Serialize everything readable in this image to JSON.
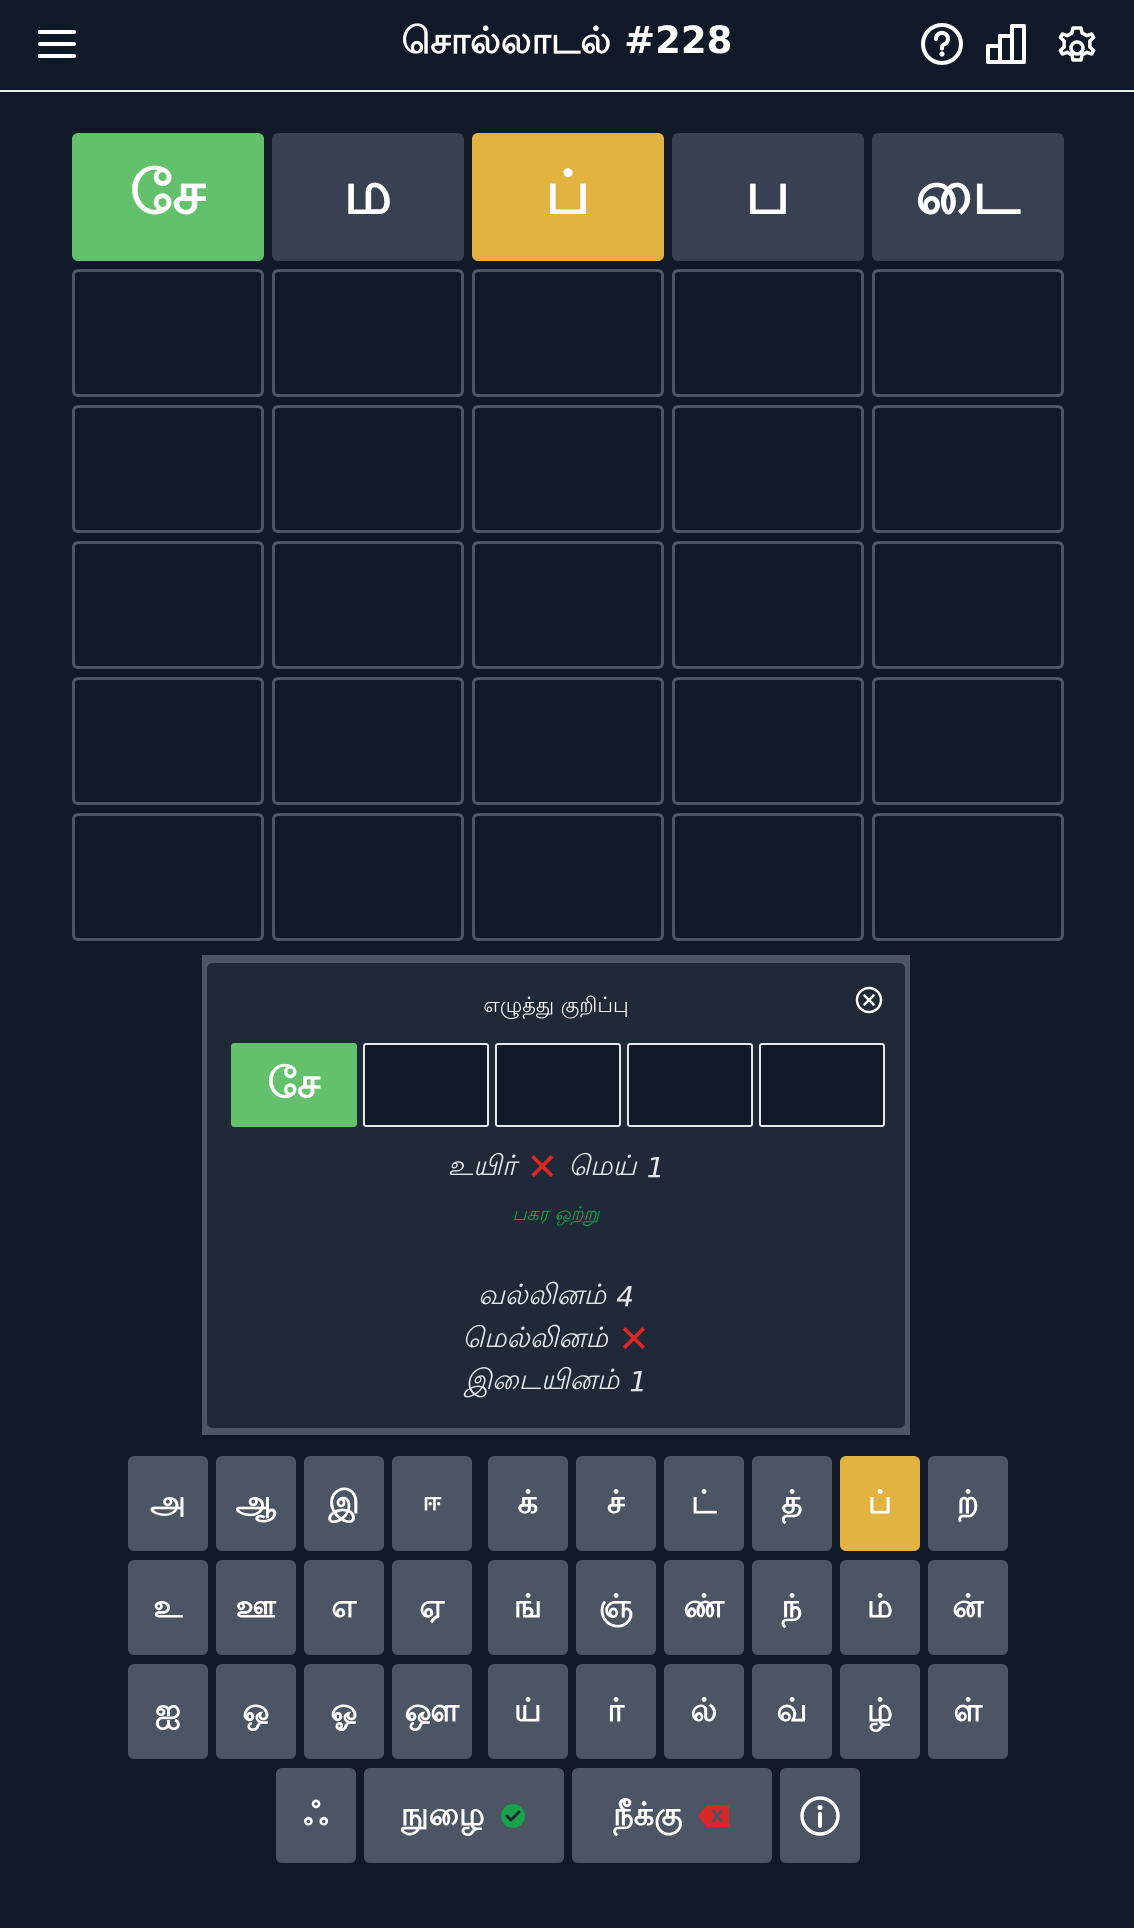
{
  "header": {
    "title": "சொல்லாடல் #228"
  },
  "colors": {
    "green": "#62c16a",
    "yellow": "#e3b341",
    "empty": "#111827",
    "dark": "#374151"
  },
  "board": {
    "rows": [
      [
        {
          "letter": "சே",
          "state": "green"
        },
        {
          "letter": "ம",
          "state": "absent"
        },
        {
          "letter": "ப்",
          "state": "yellow"
        },
        {
          "letter": "ப",
          "state": "absent"
        },
        {
          "letter": "டை",
          "state": "absent"
        }
      ],
      [
        {
          "letter": "",
          "state": "empty"
        },
        {
          "letter": "",
          "state": "empty"
        },
        {
          "letter": "",
          "state": "empty"
        },
        {
          "letter": "",
          "state": "empty"
        },
        {
          "letter": "",
          "state": "empty"
        }
      ],
      [
        {
          "letter": "",
          "state": "empty"
        },
        {
          "letter": "",
          "state": "empty"
        },
        {
          "letter": "",
          "state": "empty"
        },
        {
          "letter": "",
          "state": "empty"
        },
        {
          "letter": "",
          "state": "empty"
        }
      ],
      [
        {
          "letter": "",
          "state": "empty"
        },
        {
          "letter": "",
          "state": "empty"
        },
        {
          "letter": "",
          "state": "empty"
        },
        {
          "letter": "",
          "state": "empty"
        },
        {
          "letter": "",
          "state": "empty"
        }
      ],
      [
        {
          "letter": "",
          "state": "empty"
        },
        {
          "letter": "",
          "state": "empty"
        },
        {
          "letter": "",
          "state": "empty"
        },
        {
          "letter": "",
          "state": "empty"
        },
        {
          "letter": "",
          "state": "empty"
        }
      ],
      [
        {
          "letter": "",
          "state": "empty"
        },
        {
          "letter": "",
          "state": "empty"
        },
        {
          "letter": "",
          "state": "empty"
        },
        {
          "letter": "",
          "state": "empty"
        },
        {
          "letter": "",
          "state": "empty"
        }
      ]
    ]
  },
  "hint": {
    "title": "எழுத்து குறிப்பு",
    "tiles": [
      {
        "letter": "சே",
        "state": "green"
      },
      {
        "letter": "",
        "state": "empty"
      },
      {
        "letter": "",
        "state": "empty"
      },
      {
        "letter": "",
        "state": "empty"
      },
      {
        "letter": "",
        "state": "empty"
      }
    ],
    "uyir_label": "உயிர்",
    "mei_label": "மெய்",
    "mei_count": "1",
    "note": "பகர ஒற்று",
    "vallinam_label": "வல்லினம்",
    "vallinam_count": "4",
    "mellinam_label": "மெல்லினம்",
    "idaiyinam_label": "இடையினம்",
    "idaiyinam_count": "1"
  },
  "keyboard": {
    "rows": [
      [
        {
          "label": "அ",
          "state": "normal"
        },
        {
          "label": "ஆ",
          "state": "normal"
        },
        {
          "label": "இ",
          "state": "normal"
        },
        {
          "label": "ஈ",
          "state": "normal"
        },
        {
          "label": "க்",
          "state": "normal"
        },
        {
          "label": "ச்",
          "state": "normal"
        },
        {
          "label": "ட்",
          "state": "normal"
        },
        {
          "label": "த்",
          "state": "normal"
        },
        {
          "label": "ப்",
          "state": "yellow"
        },
        {
          "label": "ற்",
          "state": "normal"
        }
      ],
      [
        {
          "label": "உ",
          "state": "normal"
        },
        {
          "label": "ஊ",
          "state": "normal"
        },
        {
          "label": "எ",
          "state": "normal"
        },
        {
          "label": "ஏ",
          "state": "normal"
        },
        {
          "label": "ங்",
          "state": "normal"
        },
        {
          "label": "ஞ்",
          "state": "normal"
        },
        {
          "label": "ண்",
          "state": "normal"
        },
        {
          "label": "ந்",
          "state": "normal"
        },
        {
          "label": "ம்",
          "state": "normal"
        },
        {
          "label": "ன்",
          "state": "normal"
        }
      ],
      [
        {
          "label": "ஐ",
          "state": "normal"
        },
        {
          "label": "ஒ",
          "state": "normal"
        },
        {
          "label": "ஓ",
          "state": "normal"
        },
        {
          "label": "ஔ",
          "state": "normal"
        },
        {
          "label": "ய்",
          "state": "normal"
        },
        {
          "label": "ர்",
          "state": "normal"
        },
        {
          "label": "ல்",
          "state": "normal"
        },
        {
          "label": "வ்",
          "state": "normal"
        },
        {
          "label": "ழ்",
          "state": "normal"
        },
        {
          "label": "ள்",
          "state": "normal"
        }
      ]
    ],
    "aytham_label": "ஃ",
    "enter_label": "நுழை",
    "delete_label": "நீக்கு"
  }
}
